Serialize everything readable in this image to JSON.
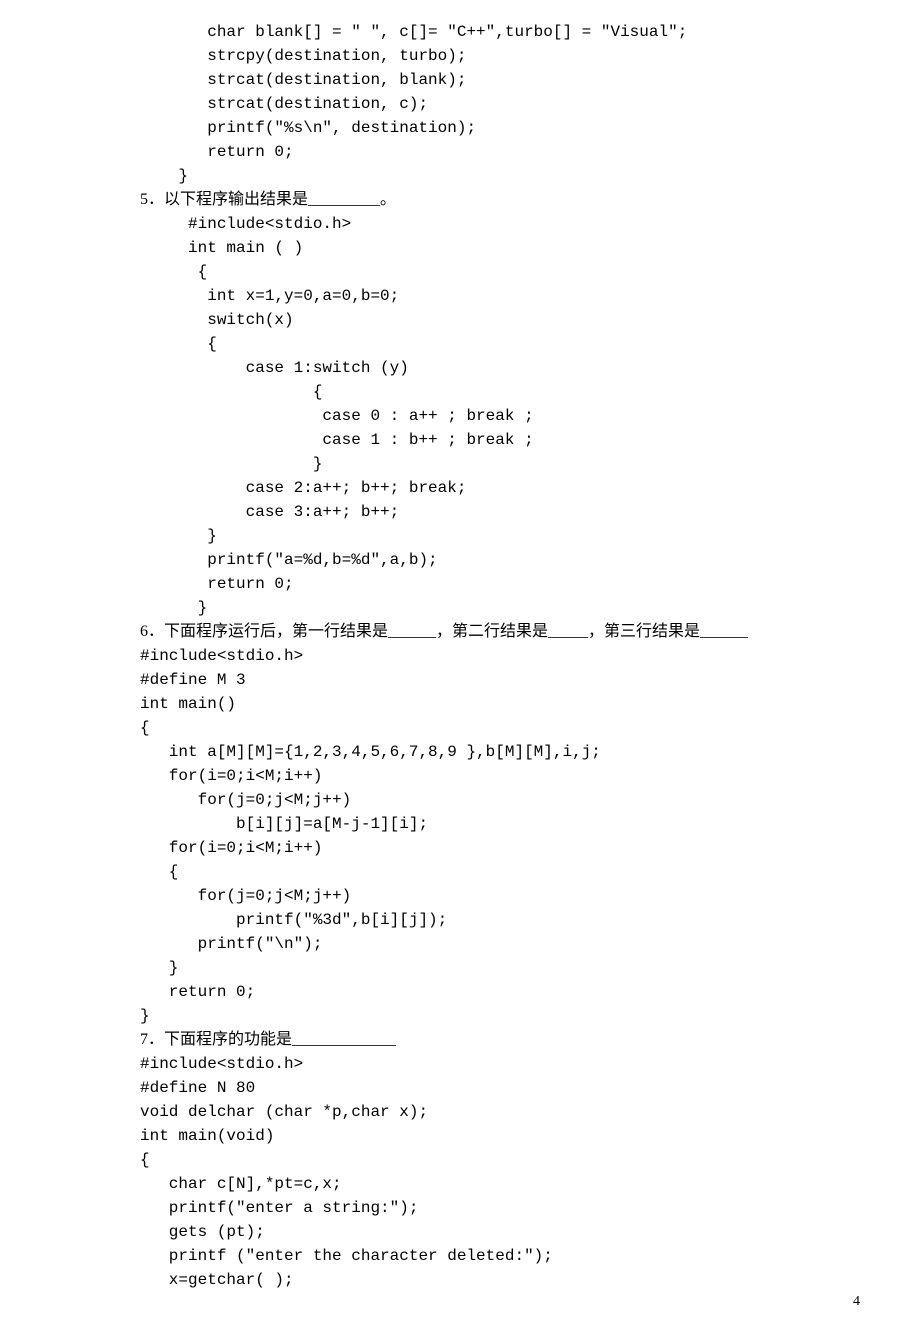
{
  "lines": [
    {
      "cls": "code-line",
      "text": "       char blank[] = \" \", c[]= \"C++\",turbo[] = \"Visual\";"
    },
    {
      "cls": "code-line",
      "text": "       strcpy(destination, turbo);"
    },
    {
      "cls": "code-line",
      "text": "       strcat(destination, blank);"
    },
    {
      "cls": "code-line",
      "text": "       strcat(destination, c);"
    },
    {
      "cls": "code-line",
      "text": "       printf(\"%s\\n\", destination);"
    },
    {
      "cls": "code-line",
      "text": "       return 0;"
    },
    {
      "cls": "code-line",
      "text": "    }"
    },
    {
      "cls": "text-line",
      "text": "5．以下程序输出结果是_________。"
    },
    {
      "cls": "code-line",
      "text": "     #include<stdio.h>"
    },
    {
      "cls": "code-line",
      "text": "     int main ( )"
    },
    {
      "cls": "code-line",
      "text": "      {"
    },
    {
      "cls": "code-line",
      "text": "       int x=1,y=0,a=0,b=0;"
    },
    {
      "cls": "code-line",
      "text": "       switch(x)"
    },
    {
      "cls": "code-line",
      "text": "       {"
    },
    {
      "cls": "code-line",
      "text": "           case 1:switch (y)"
    },
    {
      "cls": "code-line",
      "text": "                  {"
    },
    {
      "cls": "code-line",
      "text": "                   case 0 : a++ ; break ;"
    },
    {
      "cls": "code-line",
      "text": "                   case 1 : b++ ; break ;"
    },
    {
      "cls": "code-line",
      "text": "                  }"
    },
    {
      "cls": "code-line",
      "text": "           case 2:a++; b++; break;"
    },
    {
      "cls": "code-line",
      "text": "           case 3:a++; b++;"
    },
    {
      "cls": "code-line",
      "text": "       }"
    },
    {
      "cls": "code-line",
      "text": "       printf(\"a=%d,b=%d\",a,b);"
    },
    {
      "cls": "code-line",
      "text": "       return 0;"
    },
    {
      "cls": "code-line",
      "text": "      }"
    },
    {
      "cls": "text-line",
      "text": "6．下面程序运行后，第一行结果是______，第二行结果是_____，第三行结果是______"
    },
    {
      "cls": "code-line",
      "text": "#include<stdio.h>"
    },
    {
      "cls": "code-line",
      "text": "#define M 3"
    },
    {
      "cls": "code-line",
      "text": "int main()"
    },
    {
      "cls": "code-line",
      "text": "{"
    },
    {
      "cls": "code-line",
      "text": "   int a[M][M]={1,2,3,4,5,6,7,8,9 },b[M][M],i,j;"
    },
    {
      "cls": "code-line",
      "text": "   for(i=0;i<M;i++)"
    },
    {
      "cls": "code-line",
      "text": "      for(j=0;j<M;j++)"
    },
    {
      "cls": "code-line",
      "text": "          b[i][j]=a[M-j-1][i];"
    },
    {
      "cls": "code-line",
      "text": "   for(i=0;i<M;i++)"
    },
    {
      "cls": "code-line",
      "text": "   {"
    },
    {
      "cls": "code-line",
      "text": "      for(j=0;j<M;j++)"
    },
    {
      "cls": "code-line",
      "text": "          printf(\"%3d\",b[i][j]);"
    },
    {
      "cls": "code-line",
      "text": "      printf(\"\\n\");"
    },
    {
      "cls": "code-line",
      "text": "   }"
    },
    {
      "cls": "code-line",
      "text": "   return 0;"
    },
    {
      "cls": "code-line",
      "text": "}"
    },
    {
      "cls": "text-line",
      "text": "7．下面程序的功能是_____________"
    },
    {
      "cls": "code-line",
      "text": "#include<stdio.h>"
    },
    {
      "cls": "code-line",
      "text": "#define N 80"
    },
    {
      "cls": "code-line",
      "text": "void delchar (char *p,char x);"
    },
    {
      "cls": "code-line",
      "text": "int main(void)"
    },
    {
      "cls": "code-line",
      "text": "{"
    },
    {
      "cls": "code-line",
      "text": "   char c[N],*pt=c,x;"
    },
    {
      "cls": "code-line",
      "text": "   printf(\"enter a string:\");"
    },
    {
      "cls": "code-line",
      "text": "   gets (pt);"
    },
    {
      "cls": "code-line",
      "text": "   printf (\"enter the character deleted:\");"
    },
    {
      "cls": "code-line",
      "text": "   x=getchar( );"
    }
  ],
  "pageNumber": "4"
}
